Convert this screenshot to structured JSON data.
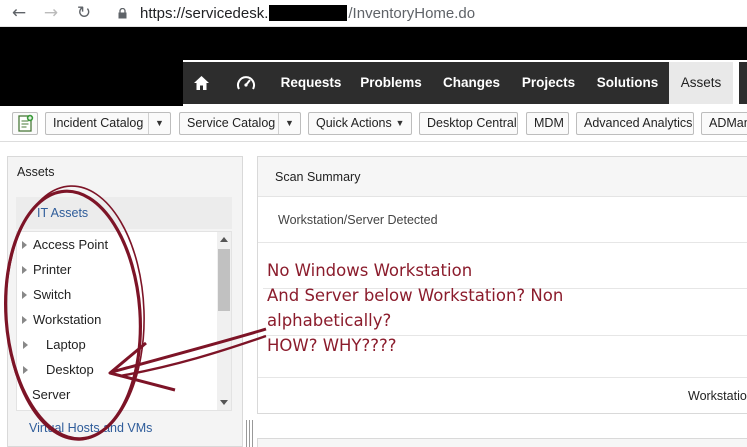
{
  "browser": {
    "url_host": "https://servicedesk.",
    "url_path": "/InventoryHome.do"
  },
  "topnav": {
    "items": [
      "Requests",
      "Problems",
      "Changes",
      "Projects",
      "Solutions",
      "Assets"
    ],
    "active": "Assets"
  },
  "toolbar": {
    "buttons": [
      "Incident Catalog",
      "Service Catalog",
      "Quick Actions",
      "Desktop Central",
      "MDM",
      "Advanced Analytics",
      "ADMan"
    ]
  },
  "left_panel": {
    "title": "Assets",
    "section": "IT Assets",
    "tree": [
      "Access Point",
      "Printer",
      "Switch",
      "Workstation",
      "Laptop",
      "Desktop",
      "Server"
    ],
    "virtual": "Virtual Hosts and VMs"
  },
  "right_panel": {
    "header": "Scan Summary",
    "subheader": "Workstation/Server Detected",
    "tail": "Workstation"
  },
  "annotation": {
    "lines": [
      "No Windows Workstation",
      "And Server below Workstation? Non",
      "alphabetically?",
      "HOW? WHY????"
    ],
    "color": "#8b1c2c"
  }
}
